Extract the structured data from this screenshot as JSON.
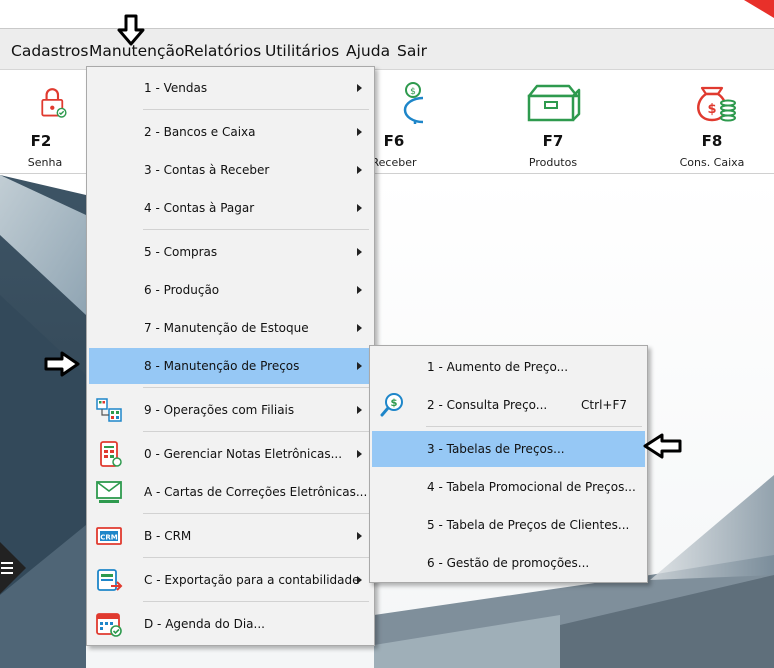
{
  "menubar": {
    "items": [
      {
        "label": "Cadastros"
      },
      {
        "label": "Manutenção"
      },
      {
        "label": "Relatórios"
      },
      {
        "label": "Utilitários"
      },
      {
        "label": "Ajuda"
      },
      {
        "label": "Sair"
      }
    ]
  },
  "toolbar": {
    "buttons": [
      {
        "key": "F2",
        "label": "Senha",
        "icon": "padlock-icon"
      },
      {
        "key": "F6",
        "label": "Receber",
        "icon": "piggy-bank-icon"
      },
      {
        "key": "F7",
        "label": "Produtos",
        "icon": "product-box-icon"
      },
      {
        "key": "F8",
        "label": "Cons. Caixa",
        "icon": "money-bag-icon"
      }
    ]
  },
  "manutencao_menu": {
    "items": [
      {
        "label": "1 - Vendas",
        "submenu": true
      },
      {
        "label": "2 - Bancos e Caixa",
        "submenu": true
      },
      {
        "label": "3 - Contas à Receber",
        "submenu": true
      },
      {
        "label": "4 - Contas à Pagar",
        "submenu": true
      },
      {
        "label": "5 - Compras",
        "submenu": true
      },
      {
        "label": "6 - Produção",
        "submenu": true
      },
      {
        "label": "7 - Manutenção de Estoque",
        "submenu": true
      },
      {
        "label": "8 - Manutenção de Preços",
        "submenu": true,
        "highlighted": true
      },
      {
        "label": "9 - Operações com Filiais",
        "submenu": true,
        "icon": "branches-icon"
      },
      {
        "label": "0 - Gerenciar Notas Eletrônicas...",
        "submenu": true,
        "icon": "electronic-invoice-icon"
      },
      {
        "label": "A - Cartas de Correções Eletrônicas...",
        "submenu": false,
        "icon": "correction-letter-icon"
      },
      {
        "label": "B - CRM",
        "submenu": true,
        "icon": "crm-icon"
      },
      {
        "label": "C - Exportação para a contabilidade",
        "submenu": true,
        "icon": "accounting-export-icon"
      },
      {
        "label": "D - Agenda do Dia...",
        "submenu": false,
        "icon": "calendar-icon"
      }
    ]
  },
  "precos_submenu": {
    "items": [
      {
        "label": "1 - Aumento de Preço..."
      },
      {
        "label": "2 - Consulta Preço...",
        "shortcut": "Ctrl+F7",
        "icon": "price-lookup-icon"
      },
      {
        "label": "3 - Tabelas de Preços...",
        "highlighted": true
      },
      {
        "label": "4 - Tabela Promocional de Preços..."
      },
      {
        "label": "5 - Tabela de Preços de Clientes..."
      },
      {
        "label": "6 - Gestão de promoções..."
      }
    ]
  },
  "colors": {
    "highlight": "#96c8f5",
    "brand_green": "#2e9a4e",
    "brand_red": "#e03a2f",
    "menu_bg": "#f2f2f2"
  }
}
